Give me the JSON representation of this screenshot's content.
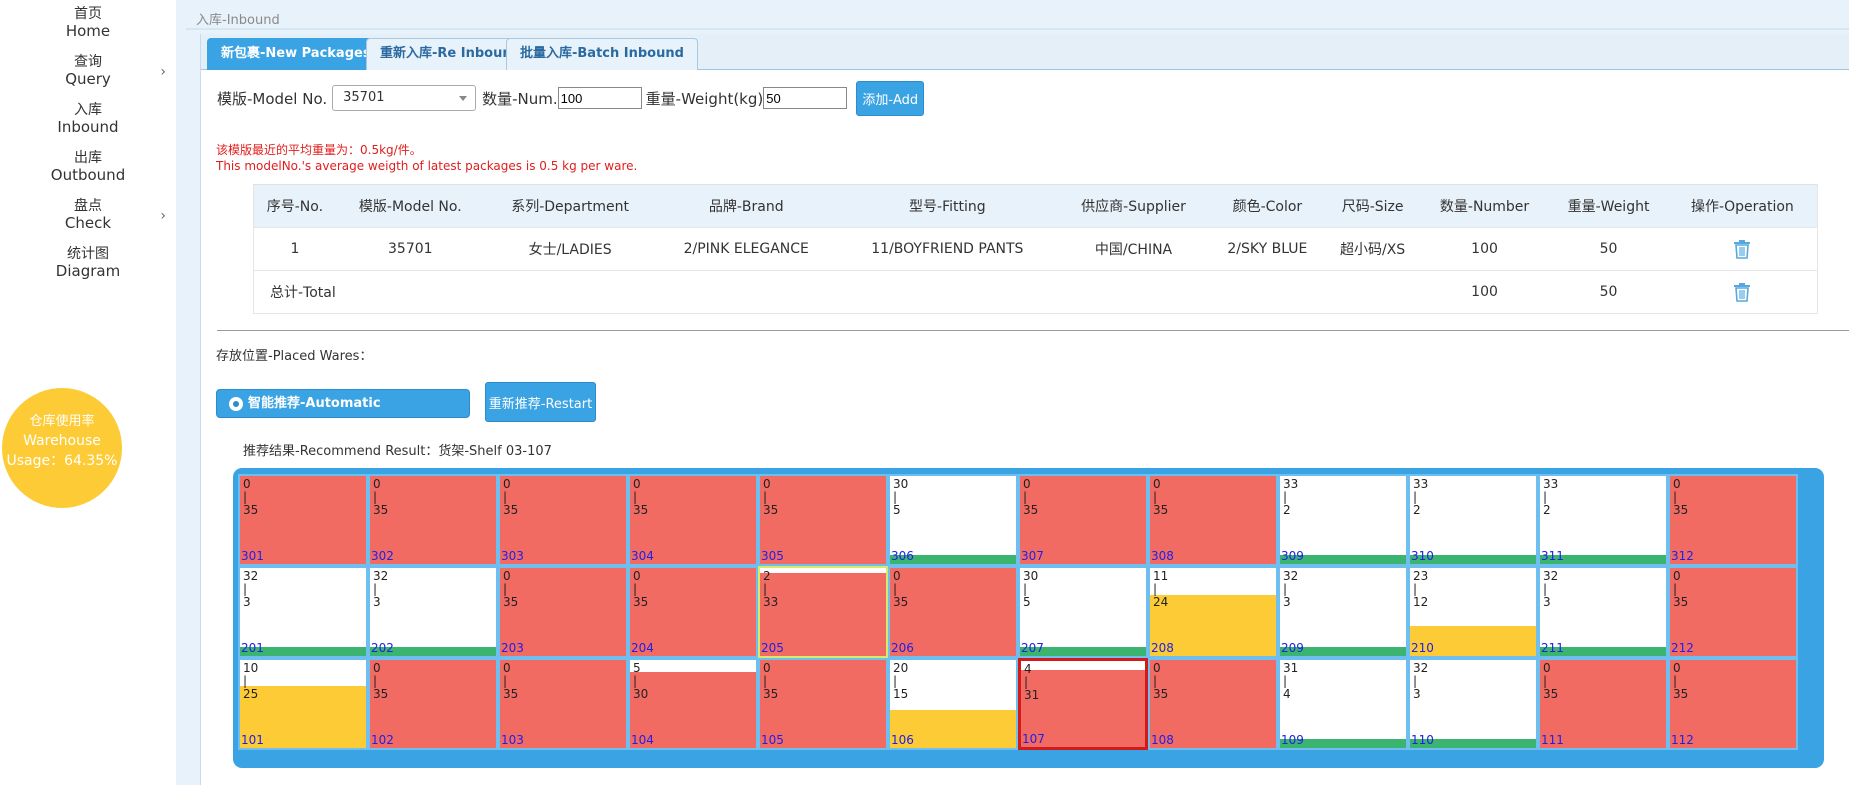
{
  "sidebar": {
    "items": [
      {
        "cn": "首页",
        "en": "Home",
        "chevron": false
      },
      {
        "cn": "查询",
        "en": "Query",
        "chevron": true
      },
      {
        "cn": "入库",
        "en": "Inbound",
        "chevron": false
      },
      {
        "cn": "出库",
        "en": "Outbound",
        "chevron": false
      },
      {
        "cn": "盘点",
        "en": "Check",
        "chevron": true
      },
      {
        "cn": "统计图",
        "en": "Diagram",
        "chevron": false
      }
    ],
    "chevron_char": "›",
    "usage": {
      "line1": "仓库使用率",
      "line2": "Warehouse",
      "line3": "Usage：64.35%"
    }
  },
  "breadcrumb": "入库-Inbound",
  "tabs": [
    "新包裹-New Packages",
    "重新入库-Re Inbound",
    "批量入库-Batch Inbound"
  ],
  "form": {
    "model_label": "模版-Model No.",
    "model_value": "35701",
    "num_label": "数量-Num.",
    "num_value": "100",
    "weight_label": "重量-Weight(kg)",
    "weight_value": "50",
    "add_button": "添加-Add"
  },
  "warning": {
    "line1": "该模版最近的平均重量为：0.5kg/件。",
    "line2": "This modelNo.'s average weigth of latest packages is 0.5 kg per ware."
  },
  "table": {
    "headers": [
      "序号-No.",
      "模版-Model No.",
      "系列-Department",
      "品牌-Brand",
      "型号-Fitting",
      "供应商-Supplier",
      "颜色-Color",
      "尺码-Size",
      "数量-Number",
      "重量-Weight",
      "操作-Operation"
    ],
    "rows": [
      [
        "1",
        "35701",
        "女士/LADIES",
        "2/PINK ELEGANCE",
        "11/BOYFRIEND PANTS",
        "中国/CHINA",
        "2/SKY BLUE",
        "超小码/XS",
        "100",
        "50"
      ]
    ],
    "total": {
      "label": "总计-Total",
      "number": "100",
      "weight": "50"
    }
  },
  "placed_label": "存放位置-Placed Wares：",
  "auto_recommend": "智能推荐-Automatic Recommend",
  "restart": "重新推荐-Restart",
  "recommend_result": "推荐结果-Recommend Result：货架-Shelf 03-107",
  "colors": {
    "full": "#f26b63",
    "green": "#3ab46e",
    "yellow": "#fdcb36",
    "accent": "#3aa3e3"
  },
  "shelves": [
    [
      {
        "id": "301",
        "top": "0",
        "bottom": "35",
        "level": 1,
        "color": "red"
      },
      {
        "id": "302",
        "top": "0",
        "bottom": "35",
        "level": 1,
        "color": "red"
      },
      {
        "id": "303",
        "top": "0",
        "bottom": "35",
        "level": 1,
        "color": "red"
      },
      {
        "id": "304",
        "top": "0",
        "bottom": "35",
        "level": 1,
        "color": "red"
      },
      {
        "id": "305",
        "top": "0",
        "bottom": "35",
        "level": 1,
        "color": "red"
      },
      {
        "id": "306",
        "top": "30",
        "bottom": "5",
        "level": 0.14,
        "color": "green"
      },
      {
        "id": "307",
        "top": "0",
        "bottom": "35",
        "level": 1,
        "color": "red"
      },
      {
        "id": "308",
        "top": "0",
        "bottom": "35",
        "level": 1,
        "color": "red"
      },
      {
        "id": "309",
        "top": "33",
        "bottom": "2",
        "level": 0.06,
        "color": "green"
      },
      {
        "id": "310",
        "top": "33",
        "bottom": "2",
        "level": 0.06,
        "color": "green"
      },
      {
        "id": "311",
        "top": "33",
        "bottom": "2",
        "level": 0.06,
        "color": "green"
      },
      {
        "id": "312",
        "top": "0",
        "bottom": "35",
        "level": 1,
        "color": "red"
      }
    ],
    [
      {
        "id": "201",
        "top": "32",
        "bottom": "3",
        "level": 0.09,
        "color": "green"
      },
      {
        "id": "202",
        "top": "32",
        "bottom": "3",
        "level": 0.09,
        "color": "green"
      },
      {
        "id": "203",
        "top": "0",
        "bottom": "35",
        "level": 1,
        "color": "red"
      },
      {
        "id": "204",
        "top": "0",
        "bottom": "35",
        "level": 1,
        "color": "red"
      },
      {
        "id": "205",
        "top": "2",
        "bottom": "33",
        "level": 0.94,
        "color": "red",
        "border": "yellow"
      },
      {
        "id": "206",
        "top": "0",
        "bottom": "35",
        "level": 1,
        "color": "red"
      },
      {
        "id": "207",
        "top": "30",
        "bottom": "5",
        "level": 0.14,
        "color": "green"
      },
      {
        "id": "208",
        "top": "11",
        "bottom": "24",
        "level": 0.69,
        "color": "yellow"
      },
      {
        "id": "209",
        "top": "32",
        "bottom": "3",
        "level": 0.09,
        "color": "green"
      },
      {
        "id": "210",
        "top": "23",
        "bottom": "12",
        "level": 0.34,
        "color": "yellow"
      },
      {
        "id": "211",
        "top": "32",
        "bottom": "3",
        "level": 0.09,
        "color": "green"
      },
      {
        "id": "212",
        "top": "0",
        "bottom": "35",
        "level": 1,
        "color": "red"
      }
    ],
    [
      {
        "id": "101",
        "top": "10",
        "bottom": "25",
        "level": 0.71,
        "color": "yellow"
      },
      {
        "id": "102",
        "top": "0",
        "bottom": "35",
        "level": 1,
        "color": "red"
      },
      {
        "id": "103",
        "top": "0",
        "bottom": "35",
        "level": 1,
        "color": "red"
      },
      {
        "id": "104",
        "top": "5",
        "bottom": "30",
        "level": 0.86,
        "color": "red"
      },
      {
        "id": "105",
        "top": "0",
        "bottom": "35",
        "level": 1,
        "color": "red"
      },
      {
        "id": "106",
        "top": "20",
        "bottom": "15",
        "level": 0.43,
        "color": "yellow"
      },
      {
        "id": "107",
        "top": "4",
        "bottom": "31",
        "level": 0.89,
        "color": "red",
        "selected": true
      },
      {
        "id": "108",
        "top": "0",
        "bottom": "35",
        "level": 1,
        "color": "red"
      },
      {
        "id": "109",
        "top": "31",
        "bottom": "4",
        "level": 0.11,
        "color": "green"
      },
      {
        "id": "110",
        "top": "32",
        "bottom": "3",
        "level": 0.09,
        "color": "green"
      },
      {
        "id": "111",
        "top": "0",
        "bottom": "35",
        "level": 1,
        "color": "red"
      },
      {
        "id": "112",
        "top": "0",
        "bottom": "35",
        "level": 1,
        "color": "red"
      }
    ]
  ]
}
